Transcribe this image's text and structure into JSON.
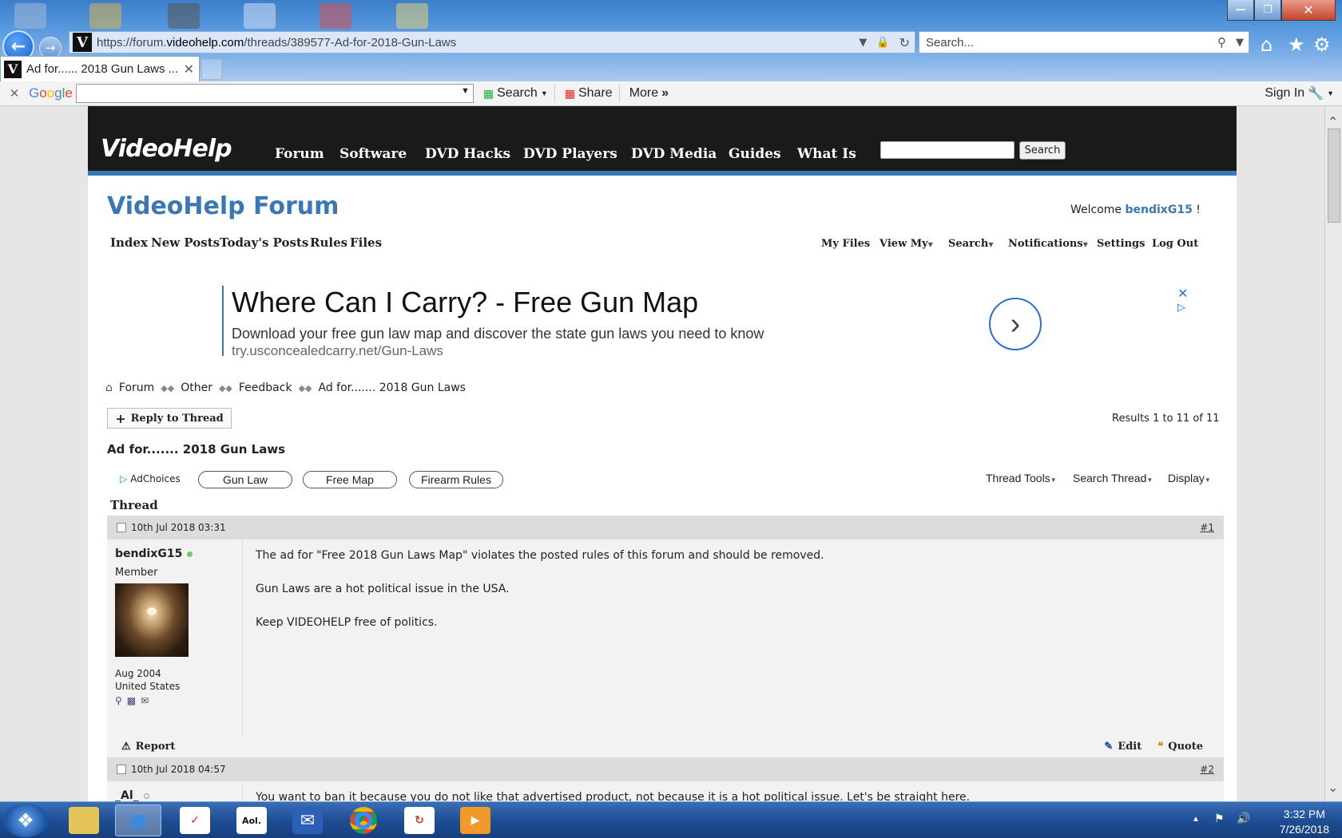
{
  "browser": {
    "url_prefix": "https://forum.",
    "url_domain": "videohelp.com",
    "url_path": "/threads/389577-Ad-for-2018-Gun-Laws",
    "search_placeholder": "Search...",
    "tab_title": "Ad for...... 2018 Gun Laws ...",
    "favicon_letter": "V"
  },
  "google_toolbar": {
    "logo": "Google",
    "search": "Search",
    "share": "Share",
    "more": "More",
    "more_glyph": "»",
    "sign_in": "Sign In"
  },
  "site": {
    "logo": "VideoHelp",
    "nav": [
      "Forum",
      "Software",
      "DVD Hacks",
      "DVD Players",
      "DVD Media",
      "Guides",
      "What Is"
    ],
    "search_button": "Search"
  },
  "forum": {
    "title": "VideoHelp Forum",
    "welcome_prefix": "Welcome",
    "welcome_user": "bendixG15",
    "welcome_suffix": "!",
    "main_nav": [
      "Index",
      "New Posts",
      "Today's Posts",
      "Rules",
      "Files"
    ],
    "user_nav": [
      "My Files",
      "View My",
      "Search",
      "Notifications",
      "Settings",
      "Log Out"
    ]
  },
  "ad": {
    "headline": "Where Can I Carry? - Free Gun Map",
    "description": "Download your free gun law map and discover the state gun laws you need to know",
    "url": "try.usconcealedcarry.net/Gun-Laws"
  },
  "breadcrumb": [
    "Forum",
    "Other",
    "Feedback",
    "Ad for....... 2018 Gun Laws"
  ],
  "thread": {
    "reply_button": "Reply to Thread",
    "results": "Results 1 to 11 of 11",
    "title": "Ad for....... 2018 Gun Laws",
    "adchoices": "AdChoices",
    "ad_pills": [
      "Gun Law",
      "Free Map",
      "Firearm Rules"
    ],
    "tools": [
      "Thread Tools",
      "Search Thread",
      "Display"
    ],
    "label": "Thread"
  },
  "posts": [
    {
      "date": "10th Jul 2018 03:31",
      "number": "#1",
      "user": "bendixG15",
      "user_title": "Member",
      "joined": "Aug 2004",
      "country": "United States",
      "paragraphs": [
        "The ad for \"Free 2018 Gun Laws Map\" violates the posted rules of this forum and should be removed.",
        "Gun Laws are a hot political issue in the USA.",
        "Keep VIDEOHELP free of politics."
      ],
      "report": "Report",
      "edit": "Edit",
      "quote": "Quote"
    },
    {
      "date": "10th Jul 2018 04:57",
      "number": "#2",
      "user": "_Al_",
      "paragraphs": [
        "You want to ban it because you do not like that advertised product, not because it is a hot political issue. Let's be straight here."
      ]
    }
  ],
  "taskbar": {
    "time": "3:32 PM",
    "date": "7/26/2018"
  }
}
